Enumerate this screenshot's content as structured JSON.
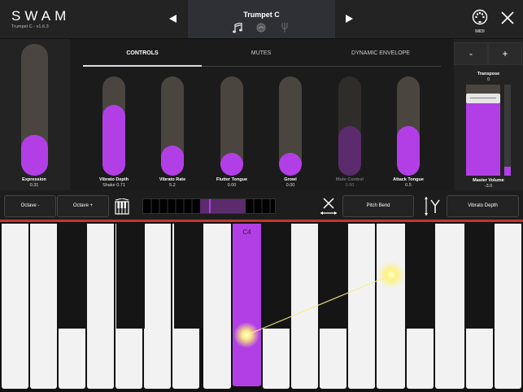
{
  "app": {
    "logo": "SWAM",
    "version": "Trumpet C - v1.6.3"
  },
  "header": {
    "preset_name": "Trumpet C",
    "prev_icon": "triangle-left-icon",
    "next_icon": "triangle-right-icon",
    "midi_label": "MIDI",
    "icons": [
      "music-note-icon",
      "circle-icon",
      "fork-icon",
      "midi-port-icon",
      "close-icon"
    ]
  },
  "tabs": [
    {
      "label": "CONTROLS",
      "active": true
    },
    {
      "label": "MUTES",
      "active": false
    },
    {
      "label": "DYNAMIC ENVELOPE",
      "active": false
    }
  ],
  "expression": {
    "label": "Expression",
    "value": "0.31",
    "level": 0.31
  },
  "sliders": [
    {
      "label": "Vibrato Depth",
      "value": "Shake 0.71",
      "level": 0.71,
      "enabled": true
    },
    {
      "label": "Vibrato Rate",
      "value": "5.2",
      "level": 0.3,
      "enabled": true
    },
    {
      "label": "Flutter Tongue",
      "value": "0.00",
      "level": 0.0,
      "enabled": true
    },
    {
      "label": "Growl",
      "value": "0.00",
      "level": 0.0,
      "enabled": true
    },
    {
      "label": "Mute Control",
      "value": "0.50",
      "level": 0.5,
      "enabled": false
    },
    {
      "label": "Attack Tongue",
      "value": "0.5",
      "level": 0.5,
      "enabled": true
    }
  ],
  "right_panel": {
    "minus_label": "-",
    "plus_label": "+",
    "transpose_label": "Transpose",
    "transpose_value": "0",
    "master_volume_label": "Master Volume",
    "master_volume_value": "-3.0",
    "master_volume_level": 0.88,
    "meter_level": 0.1
  },
  "controls_row": {
    "octave_minus": "Octave -",
    "octave_plus": "Octave +",
    "pitch_bend": "Pitch Bend",
    "vibrato_depth": "Vibrato Depth"
  },
  "keyboard": {
    "pressed_key_label": "C4"
  },
  "colors": {
    "accent": "#b23fe6",
    "background": "#1b1b1b",
    "track": "#4a463f",
    "red_line": "#c0392b"
  }
}
